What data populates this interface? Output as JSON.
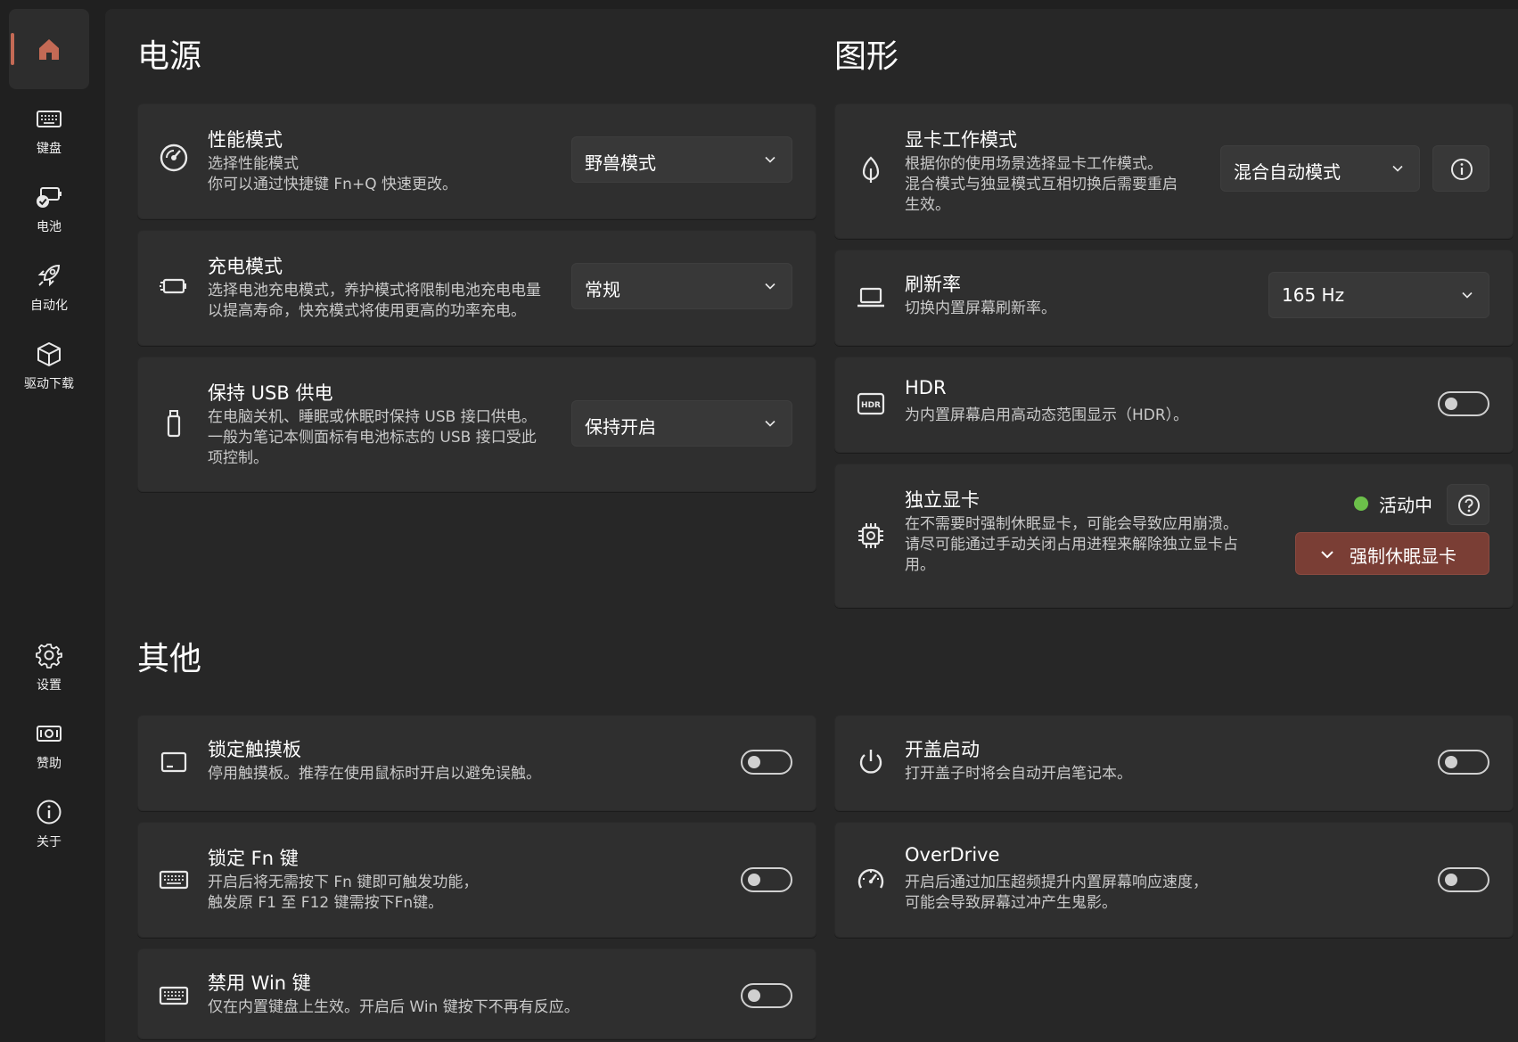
{
  "sidebar": {
    "items": [
      {
        "label": "",
        "icon": "home-icon"
      },
      {
        "label": "键盘",
        "icon": "keyboard-icon"
      },
      {
        "label": "电池",
        "icon": "battery-icon"
      },
      {
        "label": "自动化",
        "icon": "rocket-icon"
      },
      {
        "label": "驱动下载",
        "icon": "package-icon"
      },
      {
        "label": "设置",
        "icon": "gear-icon"
      },
      {
        "label": "赞助",
        "icon": "money-icon"
      },
      {
        "label": "关于",
        "icon": "info-icon"
      }
    ],
    "accent_color": "#c46a55"
  },
  "power": {
    "title": "电源",
    "performance": {
      "title": "性能模式",
      "desc1": "选择性能模式",
      "desc2": "你可以通过快捷键 Fn+Q 快速更改。",
      "value": "野兽模式"
    },
    "charging": {
      "title": "充电模式",
      "desc1": "选择电池充电模式，养护模式将限制电池充电电量",
      "desc2": "以提高寿命，快充模式将使用更高的功率充电。",
      "value": "常规"
    },
    "usb": {
      "title": "保持 USB 供电",
      "desc1": "在电脑关机、睡眠或休眠时保持 USB 接口供电。",
      "desc2": "一般为笔记本侧面标有电池标志的 USB 接口受此",
      "desc3": "项控制。",
      "value": "保持开启"
    }
  },
  "graphics": {
    "title": "图形",
    "gpu_mode": {
      "title": "显卡工作模式",
      "desc1": "根据你的使用场景选择显卡工作模式。",
      "desc2": "混合模式与独显模式互相切换后需要重启",
      "desc3": "生效。",
      "value": "混合自动模式"
    },
    "refresh": {
      "title": "刷新率",
      "desc1": "切换内置屏幕刷新率。",
      "value": "165 Hz"
    },
    "hdr": {
      "title": "HDR",
      "desc1": "为内置屏幕启用高动态范围显示（HDR）。",
      "enabled": false
    },
    "dgpu": {
      "title": "独立显卡",
      "desc1": "在不需要时强制休眠显卡，可能会导致应用崩溃。",
      "desc2": "请尽可能通过手动关闭占用进程来解除独立显卡占",
      "desc3": "用。",
      "status": "活动中",
      "status_color": "#6cc04a",
      "button": "强制休眠显卡",
      "button_color": "#7a3e35"
    }
  },
  "other": {
    "title": "其他",
    "touchpad": {
      "title": "锁定触摸板",
      "desc1": "停用触摸板。推荐在使用鼠标时开启以避免误触。",
      "enabled": false
    },
    "fnlock": {
      "title": "锁定 Fn 键",
      "desc1": "开启后将无需按下 Fn 键即可触发功能，",
      "desc2": "触发原 F1 至 F12 键需按下Fn键。",
      "enabled": false
    },
    "winkey": {
      "title": "禁用 Win 键",
      "desc1": "仅在内置键盘上生效。开启后 Win 键按下不再有反应。",
      "enabled": false
    },
    "lid": {
      "title": "开盖启动",
      "desc1": "打开盖子时将会自动开启笔记本。",
      "enabled": false
    },
    "overdrive": {
      "title": "OverDrive",
      "desc1": "开启后通过加压超频提升内置屏幕响应速度，",
      "desc2": "可能会导致屏幕过冲产生鬼影。",
      "enabled": false
    }
  }
}
